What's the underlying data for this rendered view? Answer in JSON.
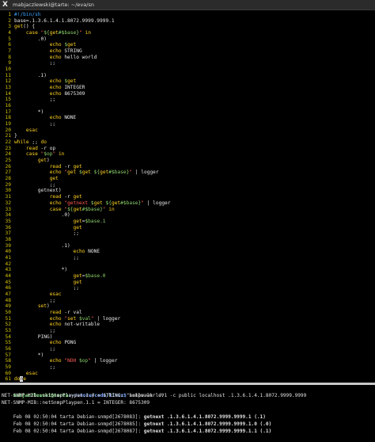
{
  "window": {
    "title": "mabjaczlewski@tarte: ~/eva/sn"
  },
  "colors": {
    "keyword": "#ffd21f",
    "string": "#ff5a5a",
    "variable": "#8cd06a",
    "shebang": "#3aa3ff",
    "linenumber": "#d4c400",
    "prompt_user": "#6fd36f",
    "prompt_path": "#7aa6ff"
  },
  "editor": {
    "lines": [
      {
        "n": "1",
        "t": "#!/bin/sh"
      },
      {
        "n": "2",
        "t": "base=.1.3.6.1.4.1.8072.9999.9999.1"
      },
      {
        "n": "3",
        "t": "get() {"
      },
      {
        "n": "4",
        "t": "    case \"${get#$base}\" in"
      },
      {
        "n": "5",
        "t": "        .0)"
      },
      {
        "n": "6",
        "t": "            echo $get"
      },
      {
        "n": "7",
        "t": "            echo STRING"
      },
      {
        "n": "8",
        "t": "            echo hello world"
      },
      {
        "n": "9",
        "t": "            ;;"
      },
      {
        "n": "10",
        "t": ""
      },
      {
        "n": "11",
        "t": "        .1)"
      },
      {
        "n": "12",
        "t": "            echo $get"
      },
      {
        "n": "13",
        "t": "            echo INTEGER"
      },
      {
        "n": "14",
        "t": "            echo 8675309"
      },
      {
        "n": "15",
        "t": "            ;;"
      },
      {
        "n": "16",
        "t": ""
      },
      {
        "n": "17",
        "t": "        *)"
      },
      {
        "n": "18",
        "t": "            echo NONE"
      },
      {
        "n": "19",
        "t": "            ;;"
      },
      {
        "n": "20",
        "t": "    esac"
      },
      {
        "n": "21",
        "t": "}"
      },
      {
        "n": "22",
        "t": "while ;; do"
      },
      {
        "n": "23",
        "t": "    read -r op"
      },
      {
        "n": "24",
        "t": "    case \"$op\" in"
      },
      {
        "n": "25",
        "t": "        get)"
      },
      {
        "n": "26",
        "t": "            read -r get"
      },
      {
        "n": "27",
        "t": "            echo \"get $get ${get#$base}\" | logger"
      },
      {
        "n": "28",
        "t": "            get"
      },
      {
        "n": "29",
        "t": "            ;;"
      },
      {
        "n": "30",
        "t": "        getnext)"
      },
      {
        "n": "31",
        "t": "            read -r get"
      },
      {
        "n": "32",
        "t": "            echo \"getnext $get ${get#$base}\" | logger"
      },
      {
        "n": "33",
        "t": "            case \"${get#$base}\" in"
      },
      {
        "n": "34",
        "t": "                .0)"
      },
      {
        "n": "35",
        "t": "                    get=$base.1"
      },
      {
        "n": "36",
        "t": "                    get"
      },
      {
        "n": "37",
        "t": "                    ;;"
      },
      {
        "n": "38",
        "t": ""
      },
      {
        "n": "39",
        "t": "                .1)"
      },
      {
        "n": "40",
        "t": "                    echo NONE"
      },
      {
        "n": "41",
        "t": "                    ;;"
      },
      {
        "n": "42",
        "t": ""
      },
      {
        "n": "43",
        "t": "                *)"
      },
      {
        "n": "44",
        "t": "                    get=$base.0"
      },
      {
        "n": "45",
        "t": "                    get"
      },
      {
        "n": "46",
        "t": "                    ;;"
      },
      {
        "n": "47",
        "t": "            esac"
      },
      {
        "n": "48",
        "t": "            ;;"
      },
      {
        "n": "49",
        "t": "        set)"
      },
      {
        "n": "50",
        "t": "            read -r val"
      },
      {
        "n": "51",
        "t": "            echo \"set $val\" | logger"
      },
      {
        "n": "52",
        "t": "            echo not-writable"
      },
      {
        "n": "53",
        "t": "            ;;"
      },
      {
        "n": "54",
        "t": "        PING)"
      },
      {
        "n": "55",
        "t": "            echo PONG"
      },
      {
        "n": "56",
        "t": "            ;;"
      },
      {
        "n": "57",
        "t": "        *)"
      },
      {
        "n": "58",
        "t": "            echo \"NOH $op\" | logger"
      },
      {
        "n": "59",
        "t": "            ;;"
      },
      {
        "n": "60",
        "t": "    esac"
      },
      {
        "n": "61",
        "t": "done"
      }
    ]
  },
  "terminal": {
    "prompt_user": "mabjaczlewski@tarta",
    "prompt_path": ":~/store/code/linux$",
    "command": " snmpwalk  -v1 -c public localhost .1.3.6.1.4.1.8072.9999.9999",
    "output1": "NET-SNMP-MIB::netSnmpPlaypen.1.0 = STRING: \"hello world\"",
    "output2": "NET-SNMP-MIB::netSnmpPlaypen.1.1 = INTEGER: 8675309",
    "log1_prefix": "Feb 08 02:50:04 tarta Debian-snmpd[2678083]: ",
    "log1_bold": "getnext .1.3.6.1.4.1.8072.9999.9999.1 (.1)",
    "log2_prefix": "Feb 08 02:50:04 tarta Debian-snmpd[2678085]: ",
    "log2_bold": "getnext .1.3.6.1.4.1.8072.9999.9999.1.0 (.0)",
    "log3_prefix": "Feb 08 02:50:04 tarta Debian-snmpd[2678087]: ",
    "log3_bold": "getnext .1.3.6.1.4.1.8072.9999.9999.1.1 (.1)"
  }
}
